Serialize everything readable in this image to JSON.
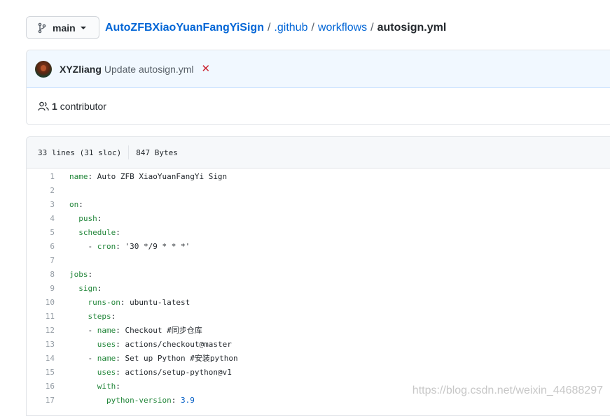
{
  "branch": {
    "label": "main"
  },
  "breadcrumb": {
    "repo": "AutoZFBXiaoYuanFangYiSign",
    "sep": "/",
    "dir1": ".github",
    "dir2": "workflows",
    "file": "autosign.yml"
  },
  "commit": {
    "author": "XYZliang",
    "message": "Update autosign.yml",
    "status_icon": "x-icon",
    "status_color": "#cb2431"
  },
  "contributors": {
    "count": "1",
    "label": "contributor"
  },
  "file_info": {
    "lines": "33 lines (31 sloc)",
    "size": "847 Bytes"
  },
  "code_lines": [
    {
      "n": "1",
      "indent": "",
      "key": "name",
      "sep": ": ",
      "value": "Auto ZFB XiaoYuanFangYi Sign",
      "vtype": "s"
    },
    {
      "n": "2",
      "indent": "",
      "key": "",
      "sep": "",
      "value": "",
      "vtype": ""
    },
    {
      "n": "3",
      "indent": "",
      "key": "on",
      "sep": ":",
      "value": "",
      "vtype": ""
    },
    {
      "n": "4",
      "indent": "  ",
      "key": "push",
      "sep": ":",
      "value": "",
      "vtype": ""
    },
    {
      "n": "5",
      "indent": "  ",
      "key": "schedule",
      "sep": ":",
      "value": "",
      "vtype": ""
    },
    {
      "n": "6",
      "indent": "    - ",
      "key": "cron",
      "sep": ": ",
      "value": "'30 */9 * * *'",
      "vtype": "s"
    },
    {
      "n": "7",
      "indent": "",
      "key": "",
      "sep": "",
      "value": "",
      "vtype": ""
    },
    {
      "n": "8",
      "indent": "",
      "key": "jobs",
      "sep": ":",
      "value": "",
      "vtype": ""
    },
    {
      "n": "9",
      "indent": "  ",
      "key": "sign",
      "sep": ":",
      "value": "",
      "vtype": ""
    },
    {
      "n": "10",
      "indent": "    ",
      "key": "runs-on",
      "sep": ": ",
      "value": "ubuntu-latest",
      "vtype": "s"
    },
    {
      "n": "11",
      "indent": "    ",
      "key": "steps",
      "sep": ":",
      "value": "",
      "vtype": ""
    },
    {
      "n": "12",
      "indent": "    - ",
      "key": "name",
      "sep": ": ",
      "value": "Checkout #同步仓库",
      "vtype": "s"
    },
    {
      "n": "13",
      "indent": "      ",
      "key": "uses",
      "sep": ": ",
      "value": "actions/checkout@master",
      "vtype": "s"
    },
    {
      "n": "14",
      "indent": "    - ",
      "key": "name",
      "sep": ": ",
      "value": "Set up Python #安装python",
      "vtype": "s"
    },
    {
      "n": "15",
      "indent": "      ",
      "key": "uses",
      "sep": ": ",
      "value": "actions/setup-python@v1",
      "vtype": "s"
    },
    {
      "n": "16",
      "indent": "      ",
      "key": "with",
      "sep": ":",
      "value": "",
      "vtype": ""
    },
    {
      "n": "17",
      "indent": "        ",
      "key": "python-version",
      "sep": ": ",
      "value": "3.9",
      "vtype": "n"
    }
  ],
  "watermark": "https://blog.csdn.net/weixin_44688297"
}
